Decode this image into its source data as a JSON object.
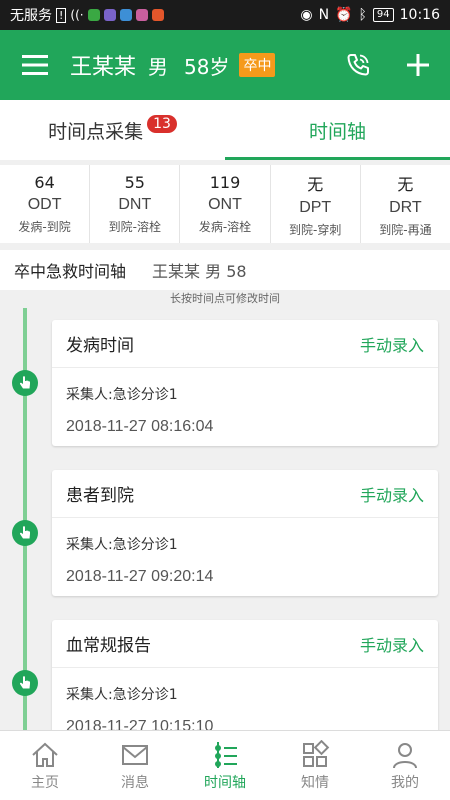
{
  "statusbar": {
    "carrier": "无服务",
    "battery": "94",
    "time": "10:16"
  },
  "header": {
    "name": "王某某",
    "sex": "男",
    "age": "58岁",
    "badge": "卒中",
    "accent": "#21a65a",
    "badge_color": "#f59a1b"
  },
  "tabs": [
    {
      "label": "时间点采集",
      "count": "13",
      "active": false
    },
    {
      "label": "时间轴",
      "active": true
    }
  ],
  "metrics": [
    {
      "value": "64",
      "code": "ODT",
      "desc": "发病-到院"
    },
    {
      "value": "55",
      "code": "DNT",
      "desc": "到院-溶栓"
    },
    {
      "value": "119",
      "code": "ONT",
      "desc": "发病-溶栓"
    },
    {
      "value": "无",
      "code": "DPT",
      "desc": "到院-穿刺"
    },
    {
      "value": "无",
      "code": "DRT",
      "desc": "到院-再通"
    }
  ],
  "section": {
    "title": "卒中急救时间轴",
    "patient": "王某某 男 58"
  },
  "hint": "长按时间点可修改时间",
  "timeline": [
    {
      "title": "发病时间",
      "action": "手动录入",
      "collector": "采集人:急诊分诊1",
      "time": "2018-11-27 08:16:04"
    },
    {
      "title": "患者到院",
      "action": "手动录入",
      "collector": "采集人:急诊分诊1",
      "time": "2018-11-27 09:20:14"
    },
    {
      "title": "血常规报告",
      "action": "手动录入",
      "collector": "采集人:急诊分诊1",
      "time": "2018-11-27 10:15:10"
    }
  ],
  "bottom_nav": [
    {
      "label": "主页",
      "icon": "home-icon",
      "active": false
    },
    {
      "label": "消息",
      "icon": "mail-icon",
      "active": false
    },
    {
      "label": "时间轴",
      "icon": "timeline-icon",
      "active": true
    },
    {
      "label": "知情",
      "icon": "grid-icon",
      "active": false
    },
    {
      "label": "我的",
      "icon": "person-icon",
      "active": false
    }
  ]
}
